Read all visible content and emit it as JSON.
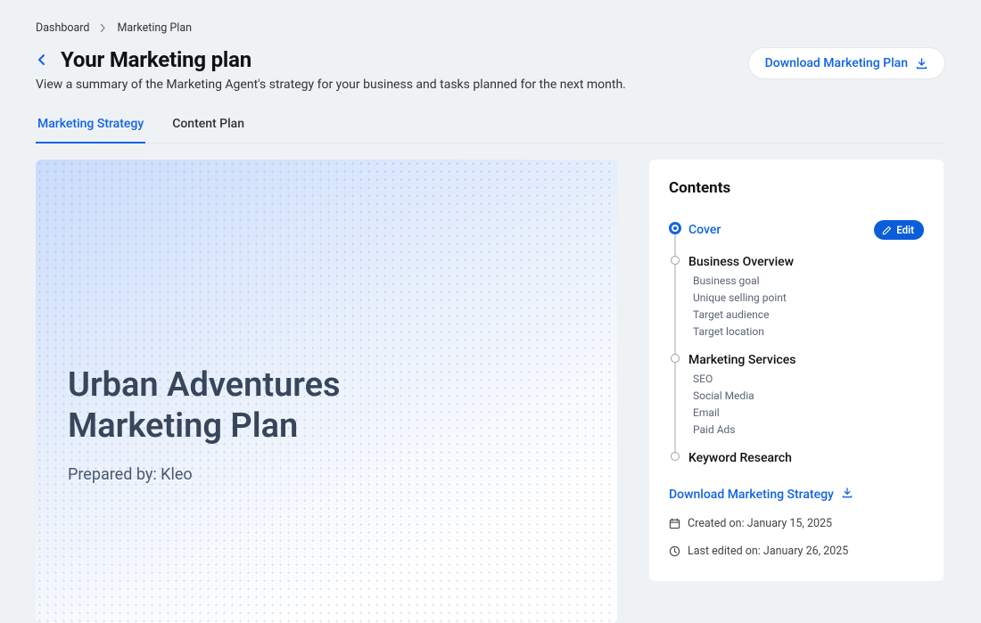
{
  "breadcrumbs": {
    "root": "Dashboard",
    "current": "Marketing Plan"
  },
  "header": {
    "title": "Your Marketing plan",
    "subtitle": "View a summary of the Marketing Agent's strategy for your business and tasks planned for the next month.",
    "download_label": "Download Marketing Plan"
  },
  "tabs": {
    "strategy": "Marketing Strategy",
    "content": "Content Plan"
  },
  "cover": {
    "title_line1": "Urban Adventures",
    "title_line2": "Marketing Plan",
    "prepared_by": "Prepared by: Kleo"
  },
  "contents": {
    "heading": "Contents",
    "edit_label": "Edit",
    "items": [
      {
        "label": "Cover",
        "active": true,
        "sub": []
      },
      {
        "label": "Business Overview",
        "active": false,
        "sub": [
          "Business goal",
          "Unique selling point",
          "Target audience",
          "Target location"
        ]
      },
      {
        "label": "Marketing Services",
        "active": false,
        "sub": [
          "SEO",
          "Social Media",
          "Email",
          "Paid Ads"
        ]
      },
      {
        "label": "Keyword Research",
        "active": false,
        "sub": []
      }
    ],
    "download_link": "Download Marketing Strategy",
    "created_label": "Created on: January 15, 2025",
    "edited_label": "Last edited on: January 26, 2025"
  }
}
